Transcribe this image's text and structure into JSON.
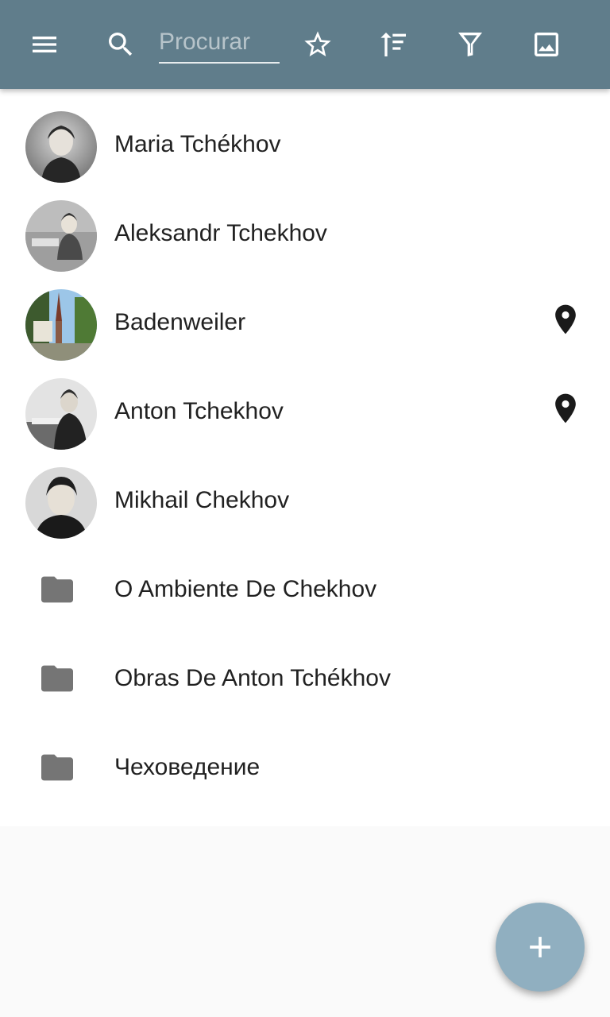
{
  "toolbar": {
    "search": {
      "placeholder": "Procurar",
      "value": ""
    },
    "icons": [
      "menu-icon",
      "search-icon",
      "star-outline-icon",
      "sort-icon",
      "filter-icon",
      "image-icon"
    ],
    "color": "#607d8b"
  },
  "list": {
    "items": [
      {
        "label": "Maria Tchékhov",
        "type": "person",
        "icon": "portrait-avatar",
        "has_location": false
      },
      {
        "label": "Aleksandr Tchekhov",
        "type": "person",
        "icon": "portrait-avatar",
        "has_location": false
      },
      {
        "label": "Badenweiler",
        "type": "place",
        "icon": "town-photo-avatar",
        "has_location": true
      },
      {
        "label": "Anton Tchekhov",
        "type": "person",
        "icon": "portrait-avatar",
        "has_location": true
      },
      {
        "label": "Mikhail Chekhov",
        "type": "person",
        "icon": "portrait-avatar",
        "has_location": false
      },
      {
        "label": "O Ambiente De Chekhov",
        "type": "folder",
        "icon": "folder-icon",
        "has_location": false
      },
      {
        "label": "Obras De Anton Tchékhov",
        "type": "folder",
        "icon": "folder-icon",
        "has_location": false
      },
      {
        "label": "Чеховедение",
        "type": "folder",
        "icon": "folder-icon",
        "has_location": false
      }
    ]
  },
  "fab": {
    "icon": "plus-icon",
    "color": "#90afc0"
  }
}
